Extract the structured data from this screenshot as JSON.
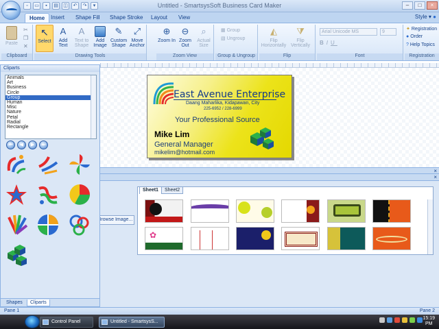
{
  "window": {
    "title": "Untitled - SmartsysSoft Business Card Maker",
    "style_menu": "Style"
  },
  "tabs": [
    "Home",
    "Insert",
    "Shape Fill",
    "Shape Stroke",
    "Layout",
    "View"
  ],
  "ribbon": {
    "clipboard": {
      "label": "Clipboard",
      "paste": "Paste"
    },
    "drawing_tools": {
      "label": "Drawing Tools",
      "buttons": [
        "Select",
        "Add Text",
        "Text to Shape",
        "Add Image",
        "Custom Shape",
        "Move Anchor"
      ]
    },
    "zoom_view": {
      "label": "Zoom View",
      "buttons": [
        "Zoom In",
        "Zoom Out",
        "Actual Size"
      ]
    },
    "group_ungroup": {
      "label": "Group & Ungroup",
      "group": "Group",
      "ungroup": "Ungroup"
    },
    "flip": {
      "label": "Flip",
      "buttons": [
        "Flip Horizontally",
        "Flip Vertically"
      ]
    },
    "font": {
      "label": "Font",
      "font_name": "Arial Unicode MS",
      "font_size": "9"
    },
    "registration": {
      "label": "Registration",
      "items": [
        "Registration",
        "Order",
        "Help Topics"
      ]
    }
  },
  "card": {
    "company": "East Avenue Enterprise",
    "address": "Daang Maharlika, Kidapawan, City",
    "phone": "225-6952 / 228-6999",
    "tagline": "Your Professional Source",
    "name": "Mike Lim",
    "title": "General Manager",
    "email": "mikelim@hotmail.com"
  },
  "cliparts": {
    "header": "Cliparts",
    "categories": [
      "Animals",
      "Art",
      "Business",
      "Circle",
      "Group",
      "Human",
      "Misc",
      "Nature",
      "Petal",
      "Radial",
      "Rectangle"
    ],
    "selected": "Group",
    "tabs": [
      "Shapes",
      "Cliparts"
    ],
    "active_tab": "Cliparts"
  },
  "bottom": {
    "browse_button": "Browse Image...",
    "sheet_tabs": [
      "Sheet1",
      "Sheet2"
    ],
    "active_sheet": "Sheet1"
  },
  "status": {
    "left": "Pane 1",
    "right": "Pane 2"
  },
  "taskbar": {
    "items": [
      "Control Panel",
      "Untitled - SmartsysS..."
    ],
    "time": "15:19",
    "pm": "PM"
  },
  "colors": {
    "ribbon_bg": "#d6e5f7",
    "accent": "#15428b",
    "card_yellow": "#ece31a",
    "selection": "#316ac5"
  }
}
